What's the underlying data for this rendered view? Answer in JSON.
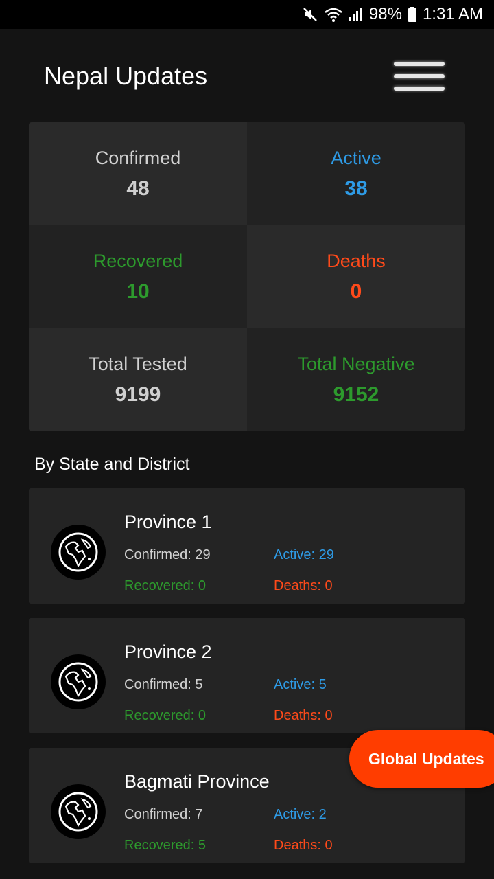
{
  "status_bar": {
    "battery": "98%",
    "time": "1:31 AM",
    "icons": [
      "mute-icon",
      "wifi-icon",
      "signal-icon",
      "battery-icon"
    ]
  },
  "app_bar": {
    "title": "Nepal Updates",
    "menu_icon": "hamburger-menu-icon"
  },
  "summary": [
    {
      "label": "Confirmed",
      "value": "48",
      "color": "#d2d2d2"
    },
    {
      "label": "Active",
      "value": "38",
      "color": "#2e9be6"
    },
    {
      "label": "Recovered",
      "value": "10",
      "color": "#2d9a2d"
    },
    {
      "label": "Deaths",
      "value": "0",
      "color": "#ff4a1a"
    },
    {
      "label": "Total Tested",
      "value": "9199",
      "color": "#d2d2d2"
    },
    {
      "label": "Total Negative",
      "value": "9152",
      "color": "#2d9a2d"
    }
  ],
  "section_title": "By State and District",
  "provinces": [
    {
      "name": "Province 1",
      "confirmed": "Confirmed: 29",
      "active": "Active: 29",
      "recovered": "Recovered: 0",
      "deaths": "Deaths: 0",
      "icon": "globe-icon"
    },
    {
      "name": "Province 2",
      "confirmed": "Confirmed: 5",
      "active": "Active: 5",
      "recovered": "Recovered: 0",
      "deaths": "Deaths: 0",
      "icon": "globe-icon"
    },
    {
      "name": "Bagmati Province",
      "confirmed": "Confirmed: 7",
      "active": "Active: 2",
      "recovered": "Recovered: 5",
      "deaths": "Deaths: 0",
      "icon": "globe-icon"
    }
  ],
  "fab": {
    "label": "Global Updates",
    "color": "#ff3d00"
  }
}
